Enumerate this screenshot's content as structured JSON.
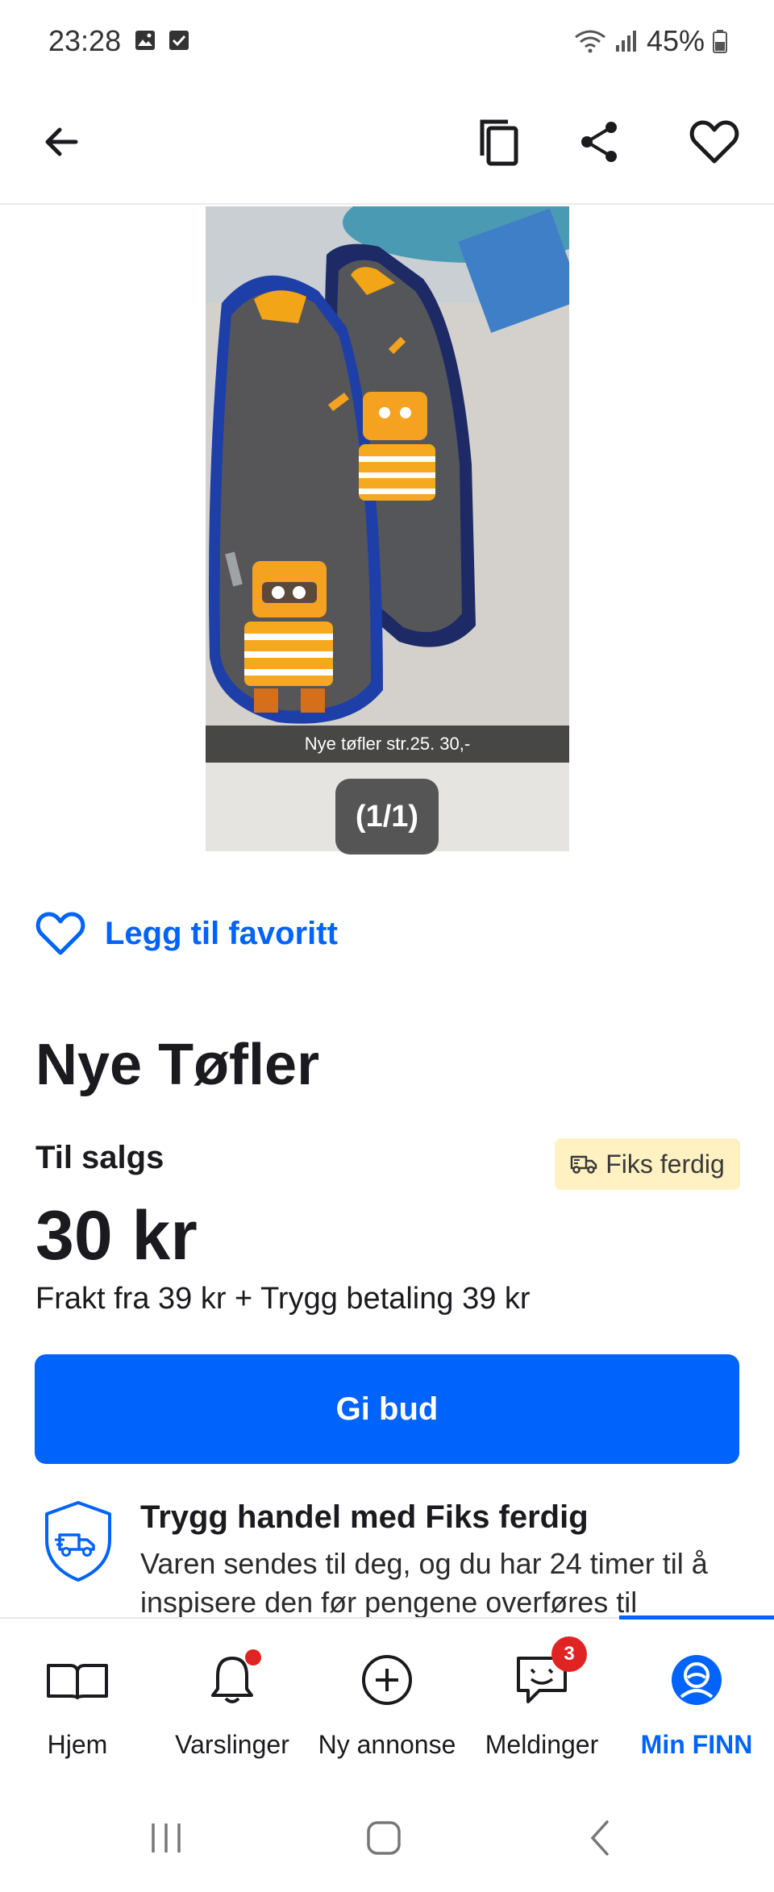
{
  "status_bar": {
    "time": "23:28",
    "battery": "45%",
    "left_icons": [
      "image-icon",
      "checkbox-icon"
    ],
    "right_icons": [
      "wifi-icon",
      "signal-icon",
      "battery-icon"
    ]
  },
  "top_bar": {
    "icons": [
      "back-arrow-icon",
      "copy-icon",
      "share-icon",
      "heart-icon"
    ]
  },
  "gallery": {
    "caption": "Nye tøfler str.25. 30,-",
    "counter": "(1/1)"
  },
  "favorite": {
    "label": "Legg til favoritt"
  },
  "listing": {
    "title": "Nye Tøfler",
    "status": "Til salgs",
    "badge": "Fiks ferdig",
    "price": "30 kr",
    "shipping": "Frakt fra 39 kr + Trygg betaling 39 kr",
    "bid_button": "Gi bud"
  },
  "safe_trade": {
    "title": "Trygg handel med Fiks ferdig",
    "body": "Varen sendes til deg, og du har 24 timer til å inspisere den før pengene overføres til"
  },
  "bottom_nav": {
    "items": [
      {
        "label": "Hjem",
        "icon": "book-icon"
      },
      {
        "label": "Varslinger",
        "icon": "bell-icon"
      },
      {
        "label": "Ny annonse",
        "icon": "plus-circle-icon"
      },
      {
        "label": "Meldinger",
        "icon": "chat-icon",
        "badge": "3"
      },
      {
        "label": "Min FINN",
        "icon": "profile-icon",
        "active": true
      }
    ]
  },
  "colors": {
    "accent": "#0063fb",
    "badge_bg": "#fff1c2",
    "notification": "#e02424"
  }
}
